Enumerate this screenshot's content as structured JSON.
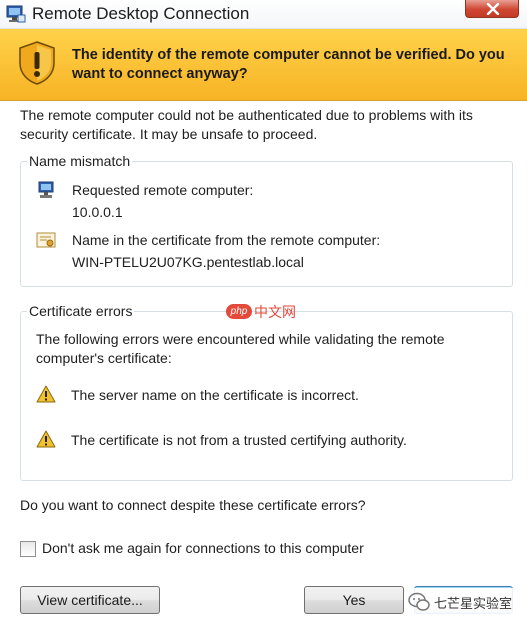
{
  "window": {
    "title": "Remote Desktop Connection",
    "close_glyph": "✕"
  },
  "banner": {
    "message": "The identity of the remote computer cannot be verified. Do you want to connect anyway?",
    "icon": "warning-shield-icon"
  },
  "intro": "The remote computer could not be authenticated due to problems with its security certificate. It may be unsafe to proceed.",
  "name_mismatch": {
    "legend": "Name mismatch",
    "requested_label": "Requested remote computer:",
    "requested_value": "10.0.0.1",
    "cert_label": "Name in the certificate from the remote computer:",
    "cert_value": "WIN-PTELU2U07KG.pentestlab.local"
  },
  "cert_errors": {
    "legend": "Certificate errors",
    "intro": "The following errors were encountered while validating the remote computer's certificate:",
    "errors": [
      "The server name on the certificate is incorrect.",
      "The certificate is not from a trusted certifying authority."
    ]
  },
  "watermark": {
    "badge": "php",
    "text": "中文网"
  },
  "question": "Do you want to connect despite these certificate errors?",
  "checkbox": {
    "label": "Don't ask me again for connections to this computer",
    "checked": false
  },
  "buttons": {
    "view_certificate": "View certificate...",
    "yes": "Yes"
  },
  "wechat_watermark": {
    "text": "七芒星实验室"
  },
  "colors": {
    "banner": "#f7b325",
    "warning": "#f2c12e",
    "close": "#c43a25"
  }
}
